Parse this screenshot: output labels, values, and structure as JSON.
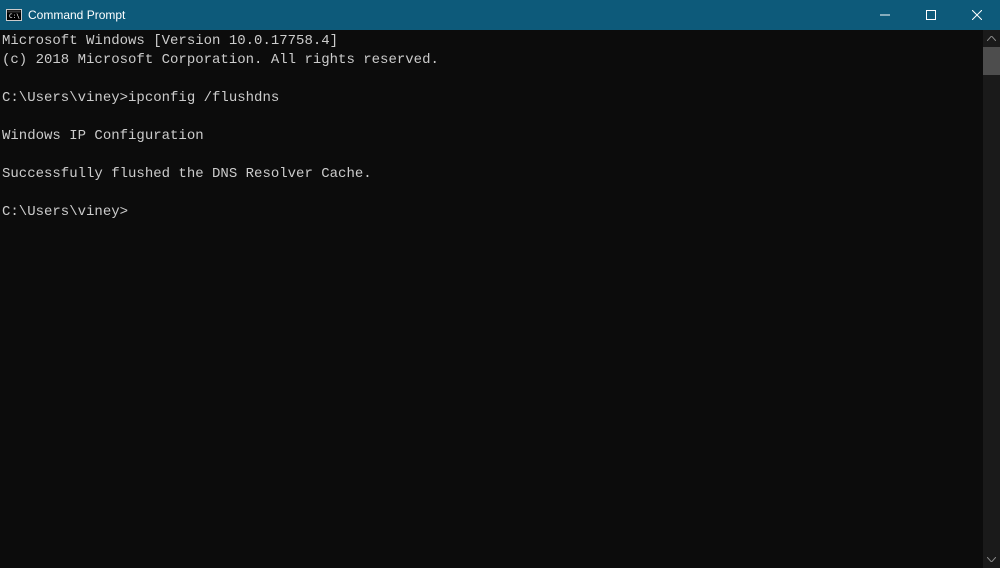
{
  "window": {
    "title": "Command Prompt"
  },
  "terminal": {
    "lines": [
      "Microsoft Windows [Version 10.0.17758.4]",
      "(c) 2018 Microsoft Corporation. All rights reserved.",
      "",
      "C:\\Users\\viney>ipconfig /flushdns",
      "",
      "Windows IP Configuration",
      "",
      "Successfully flushed the DNS Resolver Cache.",
      "",
      "C:\\Users\\viney>"
    ]
  }
}
